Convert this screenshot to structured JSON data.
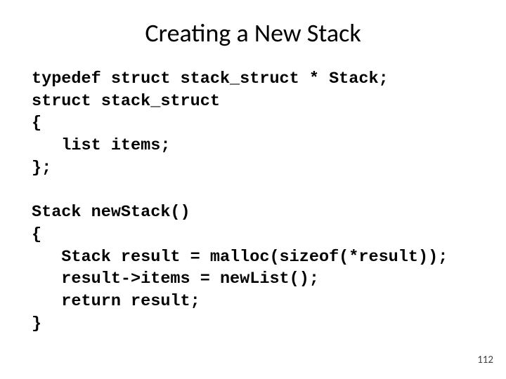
{
  "title": "Creating a New Stack",
  "code": {
    "line1": "typedef struct stack_struct * Stack;",
    "line2": "struct stack_struct",
    "line3": "{",
    "line4": "   list items;",
    "line5": "};",
    "line6": "",
    "line7": "Stack newStack()",
    "line8": "{",
    "line9": "   Stack result = malloc(sizeof(*result));",
    "line10": "   result->items = newList();",
    "line11": "   return result;",
    "line12": "}"
  },
  "page_number": "112"
}
